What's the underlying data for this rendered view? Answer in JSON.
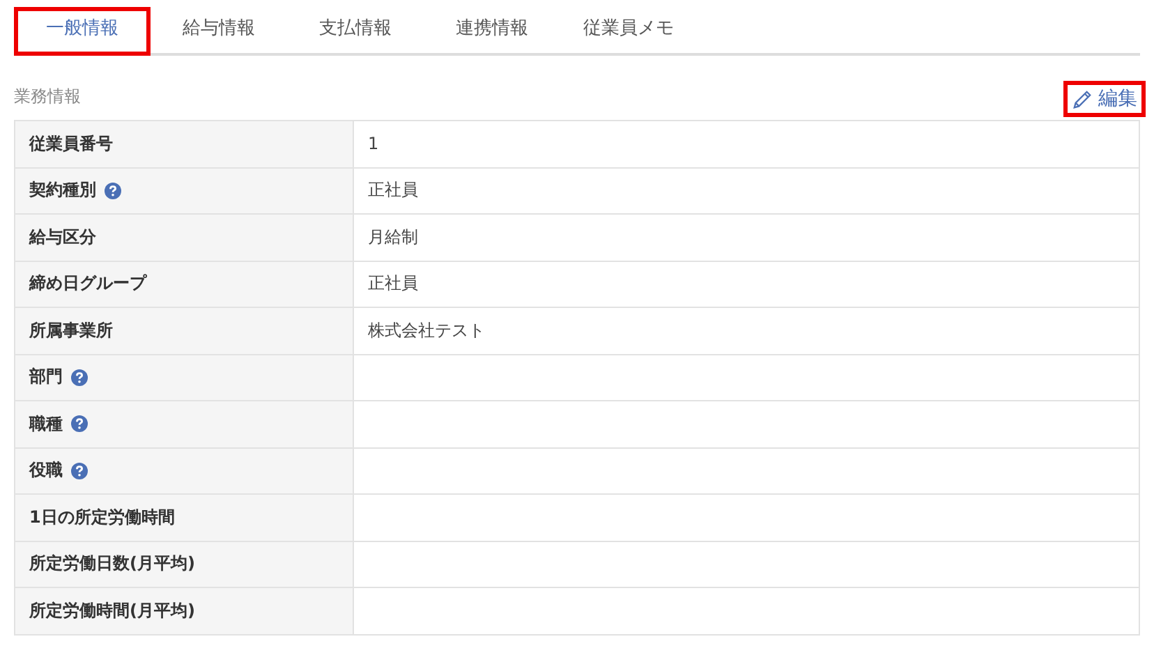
{
  "tabs": [
    {
      "label": "一般情報",
      "selected": true,
      "highlighted": true
    },
    {
      "label": "給与情報",
      "selected": false,
      "highlighted": false
    },
    {
      "label": "支払情報",
      "selected": false,
      "highlighted": false
    },
    {
      "label": "連携情報",
      "selected": false,
      "highlighted": false
    },
    {
      "label": "従業員メモ",
      "selected": false,
      "highlighted": false
    }
  ],
  "section": {
    "title": "業務情報",
    "edit_link": {
      "label": "編集",
      "highlighted": true
    }
  },
  "rows": [
    {
      "label": "従業員番号",
      "help": false,
      "value": "1"
    },
    {
      "label": "契約種別",
      "help": true,
      "value": "正社員"
    },
    {
      "label": "給与区分",
      "help": false,
      "value": "月給制"
    },
    {
      "label": "締め日グループ",
      "help": false,
      "value": "正社員"
    },
    {
      "label": "所属事業所",
      "help": false,
      "value": "株式会社テスト"
    },
    {
      "label": "部門",
      "help": true
    },
    {
      "label": "職種",
      "help": true
    },
    {
      "label": "役職",
      "help": true
    },
    {
      "label": "1日の所定労働時間",
      "help": false
    },
    {
      "label": "所定労働日数(月平均)",
      "help": false
    },
    {
      "label": "所定労働時間(月平均)",
      "help": false
    }
  ]
}
